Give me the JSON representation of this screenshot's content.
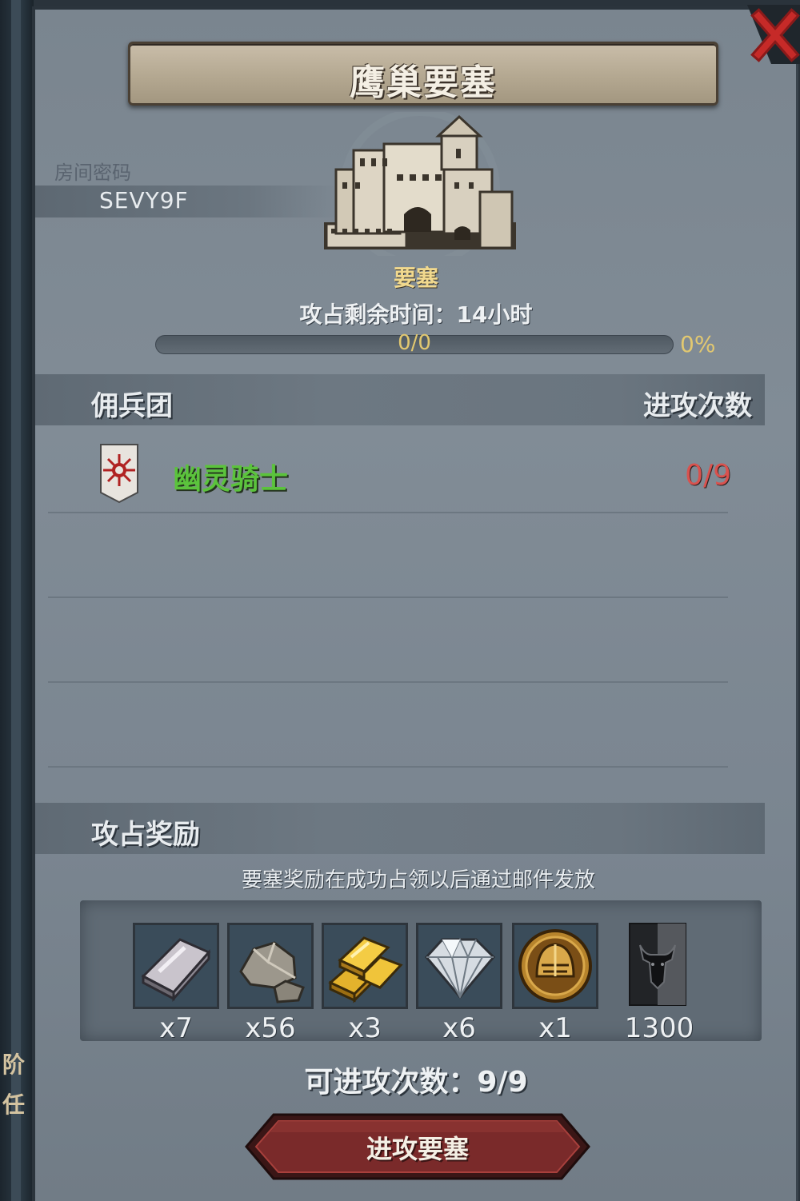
{
  "side_glyphs": [
    "阶",
    "任"
  ],
  "title": "鹰巢要塞",
  "room": {
    "label": "房间密码",
    "code": "SEVY9F"
  },
  "fortress": {
    "label": "要塞",
    "remaining_time": "攻占剩余时间：14小时",
    "progress_text": "0/0",
    "progress_percent": "0%",
    "progress_fraction": 0
  },
  "guild_section": {
    "title": "佣兵团",
    "attacks_header": "进攻次数"
  },
  "guilds": [
    {
      "name": "幽灵骑士",
      "attacks": "0/9",
      "name_color": "#5bc33c",
      "attacks_color": "#d9524e"
    }
  ],
  "rewards_section": {
    "title": "攻占奖励",
    "note": "要塞奖励在成功占领以后通过邮件发放",
    "items": [
      {
        "icon": "silver-ingot-icon",
        "qty": "x7"
      },
      {
        "icon": "stone-icon",
        "qty": "x56"
      },
      {
        "icon": "gold-bars-icon",
        "qty": "x3"
      },
      {
        "icon": "diamond-icon",
        "qty": "x6"
      },
      {
        "icon": "knight-helmet-coin-icon",
        "qty": "x1"
      },
      {
        "icon": "bull-emblem-icon",
        "qty": "1300"
      }
    ]
  },
  "attack_count": "可进攻次数：9/9",
  "attack_button": "进攻要塞",
  "colors": {
    "accent_gold": "#e2c870",
    "fortress_label": "#f1d98e",
    "button_red": "#7a2a2a"
  }
}
